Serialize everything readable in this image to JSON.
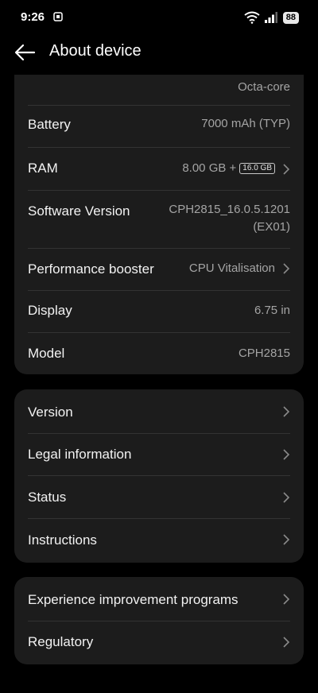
{
  "status_bar": {
    "time": "9:26",
    "battery": "88"
  },
  "header": {
    "title": "About device"
  },
  "specs_card": {
    "processor_value": "Octa-core",
    "rows": [
      {
        "label": "Battery",
        "value": "7000 mAh (TYP)"
      },
      {
        "label": "RAM",
        "value": "8.00 GB +",
        "badge": "16.0 GB"
      },
      {
        "label": "Software Version",
        "value_line1": "CPH2815_16.0.5.1201",
        "value_line2": "(EX01)"
      },
      {
        "label": "Performance booster",
        "value": "CPU Vitalisation"
      },
      {
        "label": "Display",
        "value": "6.75 in"
      },
      {
        "label": "Model",
        "value": "CPH2815"
      }
    ]
  },
  "info_card": {
    "items": [
      {
        "label": "Version"
      },
      {
        "label": "Legal information"
      },
      {
        "label": "Status"
      },
      {
        "label": "Instructions"
      }
    ]
  },
  "programs_card": {
    "items": [
      {
        "label": "Experience improvement programs"
      },
      {
        "label": "Regulatory"
      }
    ]
  },
  "colors": {
    "background": "#000000",
    "card": "#1c1c1c",
    "divider": "#333333",
    "primary_text": "#f2f2f2",
    "secondary_text": "#a4a4a4"
  }
}
